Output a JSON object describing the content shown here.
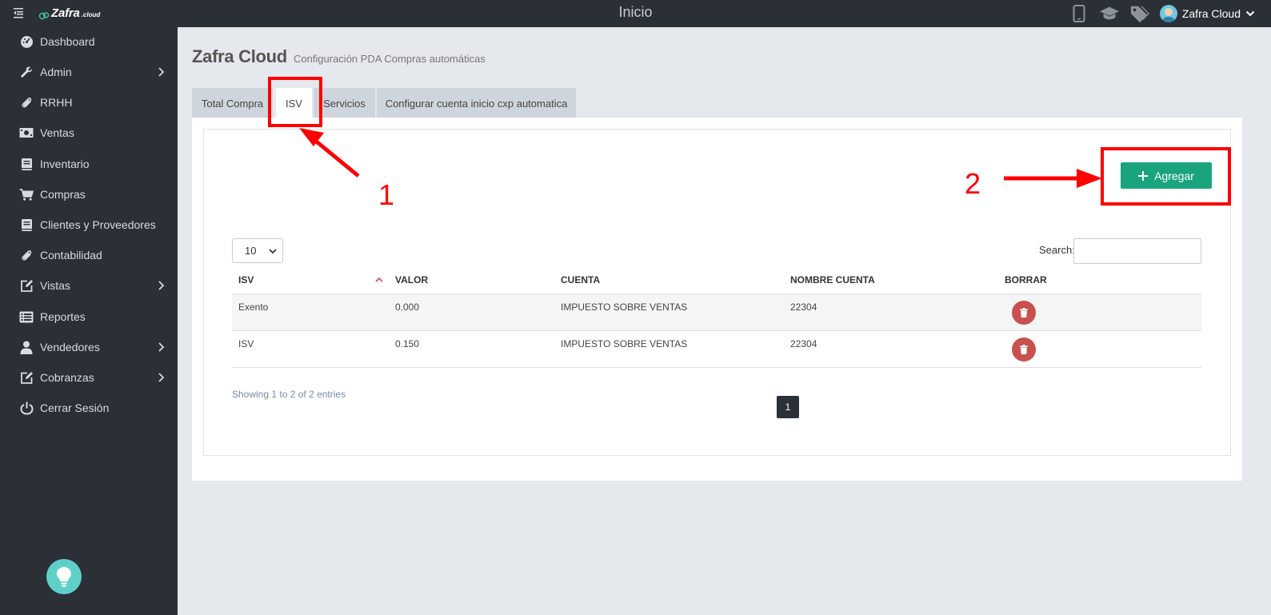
{
  "header": {
    "brand": "Zafra",
    "brand_suffix": ".cloud",
    "title": "Inicio",
    "user_name": "Zafra Cloud"
  },
  "sidebar": {
    "items": [
      {
        "label": "Dashboard",
        "icon": "dashboard-icon",
        "has_submenu": false
      },
      {
        "label": "Admin",
        "icon": "wrench-icon",
        "has_submenu": true
      },
      {
        "label": "RRHH",
        "icon": "paperclip-icon",
        "has_submenu": false
      },
      {
        "label": "Ventas",
        "icon": "money-icon",
        "has_submenu": false
      },
      {
        "label": "Inventario",
        "icon": "book-icon",
        "has_submenu": false
      },
      {
        "label": "Compras",
        "icon": "cart-icon",
        "has_submenu": false
      },
      {
        "label": "Clientes y Proveedores",
        "icon": "book-icon",
        "has_submenu": false
      },
      {
        "label": "Contabilidad",
        "icon": "paperclip-icon",
        "has_submenu": false
      },
      {
        "label": "Vistas",
        "icon": "edit-icon",
        "has_submenu": true
      },
      {
        "label": "Reportes",
        "icon": "list-icon",
        "has_submenu": false
      },
      {
        "label": "Vendedores",
        "icon": "user-icon",
        "has_submenu": true
      },
      {
        "label": "Cobranzas",
        "icon": "edit-icon",
        "has_submenu": true
      },
      {
        "label": "Cerrar Sesión",
        "icon": "power-icon",
        "has_submenu": false
      }
    ]
  },
  "page": {
    "title": "Zafra Cloud",
    "subtitle": "Configuración PDA Compras automáticas"
  },
  "tabs": [
    {
      "label": "Total Compra",
      "active": false
    },
    {
      "label": "ISV",
      "active": true
    },
    {
      "label": "Servicios",
      "active": false
    },
    {
      "label": "Configurar cuenta inicio cxp automatica",
      "active": false
    }
  ],
  "toolbar": {
    "add_label": "Agregar"
  },
  "table": {
    "page_length": "10",
    "search_label": "Search:",
    "search_value": "",
    "columns": [
      "ISV",
      "VALOR",
      "CUENTA",
      "NOMBRE CUENTA",
      "BORRAR"
    ],
    "rows": [
      {
        "isv": "Exento",
        "valor": "0.000",
        "cuenta": "IMPUESTO SOBRE VENTAS",
        "nombre_cuenta": "22304"
      },
      {
        "isv": "ISV",
        "valor": "0.150",
        "cuenta": "IMPUESTO SOBRE VENTAS",
        "nombre_cuenta": "22304"
      }
    ],
    "info": "Showing 1 to 2 of 2 entries",
    "current_page": "1"
  },
  "annotations": {
    "label_1": "1",
    "label_2": "2"
  },
  "colors": {
    "sidebar_bg": "#2b2f36",
    "accent_green": "#1aa37f",
    "delete_red": "#c9504e",
    "annotation_red": "#ff0000"
  }
}
